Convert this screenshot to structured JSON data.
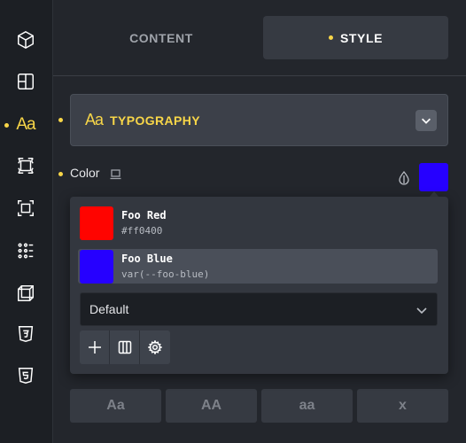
{
  "tabs": {
    "content_label": "CONTENT",
    "style_label": "STYLE"
  },
  "sidebar": {
    "items": [
      {
        "icon": "cube-icon"
      },
      {
        "icon": "layout-icon"
      },
      {
        "icon": "typography-icon",
        "label": "Aa",
        "active": true
      },
      {
        "icon": "spacing-icon"
      },
      {
        "icon": "border-icon"
      },
      {
        "icon": "grid-dots-icon"
      },
      {
        "icon": "transform-icon"
      },
      {
        "icon": "css3-icon"
      },
      {
        "icon": "html5-icon"
      }
    ]
  },
  "typography": {
    "icon_label": "Aa",
    "title": "TYPOGRAPHY"
  },
  "color_field": {
    "label": "Color",
    "current_color": "#2600ff"
  },
  "popup": {
    "palette": [
      {
        "name": "Foo Red",
        "value": "#ff0400",
        "swatch": "#ff0400"
      },
      {
        "name": "Foo Blue",
        "value": "var(--foo-blue)",
        "swatch": "#2600ff",
        "selected": true
      }
    ],
    "select_value": "Default"
  },
  "case_buttons": [
    "Aa",
    "AA",
    "aa",
    "x"
  ],
  "colors": {
    "accent": "#f8d648",
    "panel_bg": "#23262c",
    "sidebar_bg": "#1c1f24"
  }
}
